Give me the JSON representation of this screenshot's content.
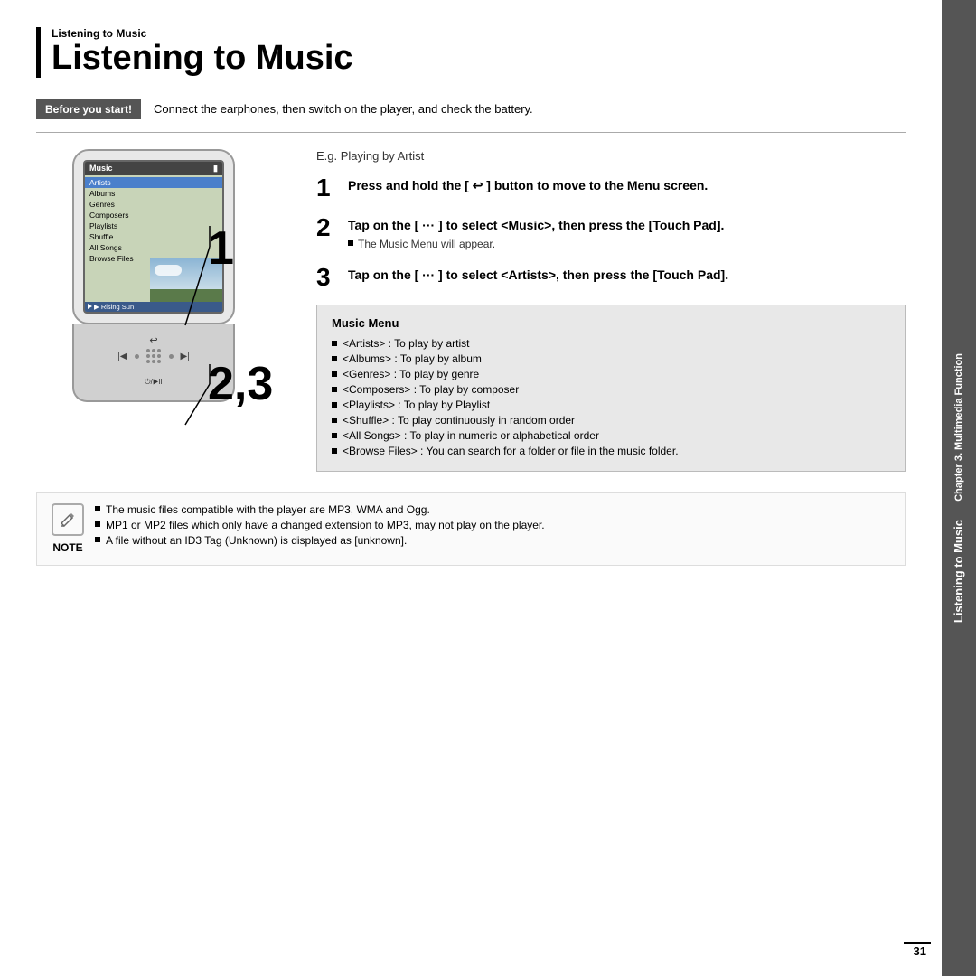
{
  "page": {
    "chapter_label": "Chapter 3. Multimedia Function",
    "header_small": "Listening to Music",
    "header_large": "Listening to Music",
    "page_number": "31"
  },
  "before_start": {
    "badge": "Before you start!",
    "text": "Connect the earphones, then switch on the player, and check the battery."
  },
  "eg_text": "E.g. Playing by Artist",
  "steps": [
    {
      "number": "1",
      "text": "Press and hold the [ ↩ ] button to move to the Menu screen."
    },
    {
      "number": "2",
      "text": "Tap on the [ ··· ] to select <Music>, then press the [Touch Pad].",
      "note": "The Music Menu will appear."
    },
    {
      "number": "3",
      "text": "Tap on the [ ··· ] to select <Artists>, then press the [Touch Pad]."
    }
  ],
  "device": {
    "screen_title": "Music",
    "battery_icon": "▃",
    "menu_items": [
      {
        "label": "Artists",
        "highlighted": true
      },
      {
        "label": "Albums",
        "highlighted": false
      },
      {
        "label": "Genres",
        "highlighted": false
      },
      {
        "label": "Composers",
        "highlighted": false
      },
      {
        "label": "Playlists",
        "highlighted": false
      },
      {
        "label": "Shuffle",
        "highlighted": false
      },
      {
        "label": "All Songs",
        "highlighted": false
      },
      {
        "label": "Browse Files",
        "highlighted": false
      }
    ],
    "now_playing": "▶ Rising Sun"
  },
  "music_menu": {
    "title": "Music Menu",
    "items": [
      "<Artists> : To play by artist",
      "<Albums> : To play by album",
      "<Genres> : To play by genre",
      "<Composers> : To play by composer",
      "<Playlists> : To play by Playlist",
      "<Shuffle> : To play continuously in random order",
      "<All Songs> : To play in numeric or alphabetical order",
      "<Browse Files> : You can search for a folder or file in the music folder."
    ]
  },
  "note": {
    "icon": "✎",
    "label": "NOTE",
    "items": [
      "The music files compatible with the player are MP3, WMA and Ogg.",
      "MP1 or MP2 files which only have a changed extension to MP3, may not play on the player.",
      "A file without an ID3 Tag (Unknown) is displayed as [unknown]."
    ]
  },
  "side_tab": {
    "top": "Chapter 3. Multimedia Function",
    "bottom": "Listening to Music"
  },
  "step_numbers_overlay": {
    "one": "1",
    "two_three": "2,3"
  }
}
